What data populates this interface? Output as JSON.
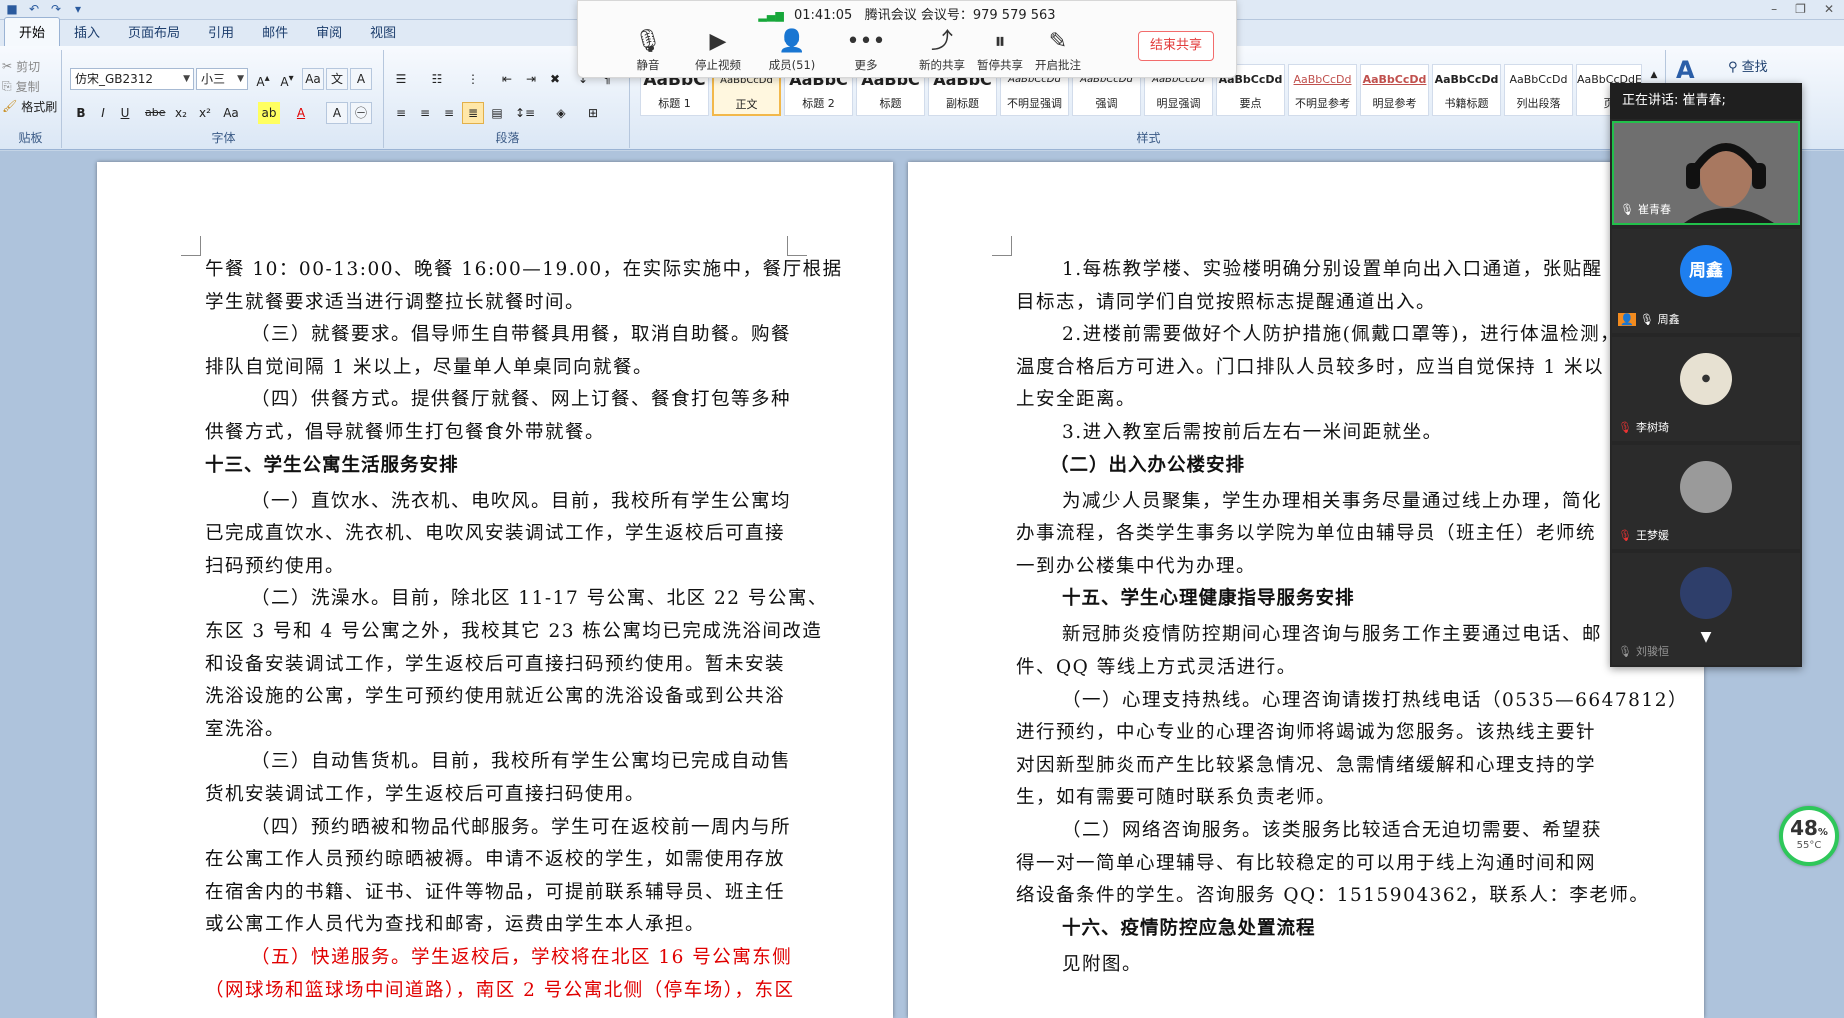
{
  "ribbon": {
    "tabs": [
      "开始",
      "插入",
      "页面布局",
      "引用",
      "邮件",
      "审阅",
      "视图"
    ],
    "clipboard": {
      "cut": "剪切",
      "copy": "复制",
      "format_painter": "格式刷",
      "label": "贴板"
    },
    "font": {
      "name": "仿宋_GB2312",
      "size": "小三",
      "label": "字体"
    },
    "paragraph_label": "段落",
    "styles_label": "样式",
    "styles": [
      {
        "sample": "AaBbC",
        "name": "标题 1"
      },
      {
        "sample": "AaBbCcDd",
        "name": "正文"
      },
      {
        "sample": "AaBbC",
        "name": "标题 2"
      },
      {
        "sample": "AaBbC",
        "name": "标题"
      },
      {
        "sample": "AaBbC",
        "name": "副标题"
      },
      {
        "sample": "AaBbCcDd",
        "name": "不明显强调"
      },
      {
        "sample": "AaBbCcDd",
        "name": "强调"
      },
      {
        "sample": "AaBbCcDd",
        "name": "明显强调"
      },
      {
        "sample": "AaBbCcDd",
        "name": "要点"
      },
      {
        "sample": "AaBbCcDd",
        "name": "不明显参考"
      },
      {
        "sample": "AaBbCcDd",
        "name": "明显参考"
      },
      {
        "sample": "AaBbCcDd",
        "name": "书籍标题"
      },
      {
        "sample": "AaBbCcDd",
        "name": "列出段落"
      },
      {
        "sample": "AaBbCcDdE",
        "name": "页"
      }
    ],
    "find": "查找"
  },
  "meeting": {
    "time": "01:41:05",
    "title": "腾讯会议 会议号：979 579 563",
    "tools": [
      "静音",
      "停止视频",
      "成员(51)",
      "更多",
      "新的共享",
      "暂停共享",
      "开启批注"
    ],
    "end_share": "结束共享",
    "speaking": "正在讲话: 崔青春;",
    "participants": [
      "崔青春",
      "周鑫",
      "李树琦",
      "王梦媛",
      "刘骏恒"
    ],
    "avatar_text": "周鑫"
  },
  "perf": {
    "percent": "48",
    "unit": "%",
    "temp": "55°C"
  },
  "left_page": [
    {
      "t": "午餐 10：00-13:00、晚餐 16:00—19.00，在实际实施中，餐厅根据",
      "cls": ""
    },
    {
      "t": "学生就餐要求适当进行调整拉长就餐时间。",
      "cls": ""
    },
    {
      "t": "（三）就餐要求。倡导师生自带餐具用餐，取消自助餐。购餐",
      "cls": "ind"
    },
    {
      "t": "排队自觉间隔 1 米以上，尽量单人单桌同向就餐。",
      "cls": ""
    },
    {
      "t": "（四）供餐方式。提供餐厅就餐、网上订餐、餐食打包等多种",
      "cls": "ind"
    },
    {
      "t": "供餐方式，倡导就餐师生打包餐食外带就餐。",
      "cls": ""
    },
    {
      "t": "十三、学生公寓生活服务安排",
      "cls": "h"
    },
    {
      "t": "（一）直饮水、洗衣机、电吹风。目前，我校所有学生公寓均",
      "cls": "ind"
    },
    {
      "t": "已完成直饮水、洗衣机、电吹风安装调试工作，学生返校后可直接",
      "cls": ""
    },
    {
      "t": "扫码预约使用。",
      "cls": ""
    },
    {
      "t": "（二）洗澡水。目前，除北区 11-17 号公寓、北区 22 号公寓、",
      "cls": "ind"
    },
    {
      "t": "东区 3 号和 4 号公寓之外，我校其它 23 栋公寓均已完成洗浴间改造",
      "cls": ""
    },
    {
      "t": "和设备安装调试工作，学生返校后可直接扫码预约使用。暂未安装",
      "cls": ""
    },
    {
      "t": "洗浴设施的公寓，学生可预约使用就近公寓的洗浴设备或到公共浴",
      "cls": ""
    },
    {
      "t": "室洗浴。",
      "cls": ""
    },
    {
      "t": "（三）自动售货机。目前，我校所有学生公寓均已完成自动售",
      "cls": "ind"
    },
    {
      "t": "货机安装调试工作，学生返校后可直接扫码使用。",
      "cls": ""
    },
    {
      "t": "（四）预约晒被和物品代邮服务。学生可在返校前一周内与所",
      "cls": "ind"
    },
    {
      "t": "在公寓工作人员预约晾晒被褥。申请不返校的学生，如需使用存放",
      "cls": ""
    },
    {
      "t": "在宿舍内的书籍、证书、证件等物品，可提前联系辅导员、班主任",
      "cls": ""
    },
    {
      "t": "或公寓工作人员代为查找和邮寄，运费由学生本人承担。",
      "cls": ""
    },
    {
      "t": "（五）快递服务。学生返校后，学校将在北区 16 号公寓东侧",
      "cls": "ind red"
    },
    {
      "t": "（网球场和篮球场中间道路），南区 2 号公寓北侧（停车场），东区",
      "cls": "red"
    }
  ],
  "right_page": [
    {
      "t": "1.每栋教学楼、实验楼明确分别设置单向出入口通道，张贴醒",
      "cls": "ind"
    },
    {
      "t": "目标志，请同学们自觉按照标志提醒通道出入。",
      "cls": ""
    },
    {
      "t": "2.进楼前需要做好个人防护措施(佩戴口罩等)，进行体温检测，",
      "cls": "ind"
    },
    {
      "t": "温度合格后方可进入。门口排队人员较多时，应当自觉保持 1 米以",
      "cls": ""
    },
    {
      "t": "上安全距离。",
      "cls": ""
    },
    {
      "t": "3.进入教室后需按前后左右一米间距就坐。",
      "cls": "ind"
    },
    {
      "t": "（二）出入办公楼安排",
      "cls": "h ind2"
    },
    {
      "t": "为减少人员聚集，学生办理相关事务尽量通过线上办理，简化",
      "cls": "ind"
    },
    {
      "t": "办事流程，各类学生事务以学院为单位由辅导员（班主任）老师统",
      "cls": ""
    },
    {
      "t": "一到办公楼集中代为办理。",
      "cls": ""
    },
    {
      "t": "十五、学生心理健康指导服务安排",
      "cls": "h ind"
    },
    {
      "t": "新冠肺炎疫情防控期间心理咨询与服务工作主要通过电话、邮",
      "cls": "ind"
    },
    {
      "t": "件、QQ 等线上方式灵活进行。",
      "cls": ""
    },
    {
      "t": "（一）心理支持热线。心理咨询请拨打热线电话（0535—6647812）",
      "cls": "ind"
    },
    {
      "t": "进行预约，中心专业的心理咨询师将竭诚为您服务。该热线主要针",
      "cls": ""
    },
    {
      "t": "对因新型肺炎而产生比较紧急情况、急需情绪缓解和心理支持的学",
      "cls": ""
    },
    {
      "t": "生，如有需要可随时联系负责老师。",
      "cls": ""
    },
    {
      "t": "（二）网络咨询服务。该类服务比较适合无迫切需要、希望获",
      "cls": "ind"
    },
    {
      "t": "得一对一简单心理辅导、有比较稳定的可以用于线上沟通时间和网",
      "cls": ""
    },
    {
      "t": "络设备条件的学生。咨询服务 QQ：1515904362，联系人：李老师。",
      "cls": ""
    },
    {
      "t": "十六、疫情防控应急处置流程",
      "cls": "h ind"
    },
    {
      "t": "见附图。",
      "cls": "ind"
    }
  ]
}
